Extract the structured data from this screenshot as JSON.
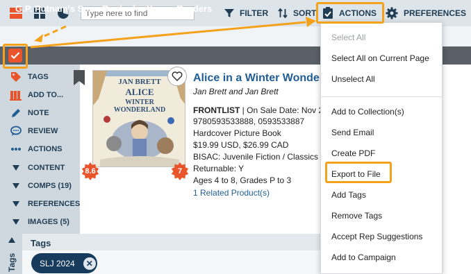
{
  "toolbar": {
    "search_placeholder": "Type here to find",
    "filter_label": "FILTER",
    "sort_label": "SORT",
    "actions_label": "ACTIONS",
    "preferences_label": "PREFERENCES"
  },
  "group": {
    "title": "G.P. Putnam's Sons Books for Young Readers"
  },
  "sidebar": {
    "items": [
      {
        "label": "TAGS",
        "icon": "tag-icon"
      },
      {
        "label": "ADD TO...",
        "icon": "add-to-icon"
      },
      {
        "label": "NOTE",
        "icon": "pencil-icon"
      },
      {
        "label": "REVIEW",
        "icon": "speech-bubble-icon"
      },
      {
        "label": "ACTIONS",
        "icon": "ellipsis-icon"
      },
      {
        "label": "CONTENT",
        "icon": "caret-down-icon"
      },
      {
        "label": "COMPS (19)",
        "icon": "caret-down-icon"
      },
      {
        "label": "REFERENCES",
        "icon": "caret-down-icon"
      },
      {
        "label": "IMAGES (5)",
        "icon": "caret-down-icon"
      }
    ],
    "tags_tab_label": "Tags"
  },
  "book": {
    "title": "Alice in a Winter Wonder",
    "authors": "Jan Brett and Jan Brett",
    "catalog": "FRONTLIST",
    "on_sale": " | On Sale Date: Nov 2",
    "isbns": "9780593533888, 0593533887",
    "format": "Hardcover Picture Book",
    "price": "$19.99 USD, $26.99 CAD",
    "bisac": "BISAC: Juvenile Fiction / Classics (",
    "returnable": "Returnable: Y",
    "ages": "Ages 4 to 8, Grades P to 3",
    "related": "1 Related Product(s)",
    "cover_author": "JAN BRETT",
    "cover_title_1": "ALICE",
    "cover_title_2": "WINTER",
    "cover_title_3": "WONDERLAND",
    "badge_left": "8.6",
    "badge_right": "7"
  },
  "tags_panel": {
    "header": "Tags",
    "chips": [
      {
        "label": "SLJ 2024"
      }
    ]
  },
  "actions_menu": {
    "items": [
      {
        "label": "Select All",
        "disabled": true
      },
      {
        "label": "Select All on Current Page"
      },
      {
        "label": "Unselect All"
      },
      {
        "label": "Add to Collection(s)"
      },
      {
        "label": "Send Email"
      },
      {
        "label": "Create PDF"
      },
      {
        "label": "Export to File"
      },
      {
        "label": "Add Tags"
      },
      {
        "label": "Remove Tags"
      },
      {
        "label": "Accept Rep Suggestions"
      },
      {
        "label": "Add to Campaign"
      }
    ]
  },
  "colors": {
    "accent_orange": "#e9542b",
    "highlight": "#f4a21b",
    "navy": "#1f3c53",
    "link_blue": "#1f5d94",
    "band_gray": "#5a6067"
  }
}
